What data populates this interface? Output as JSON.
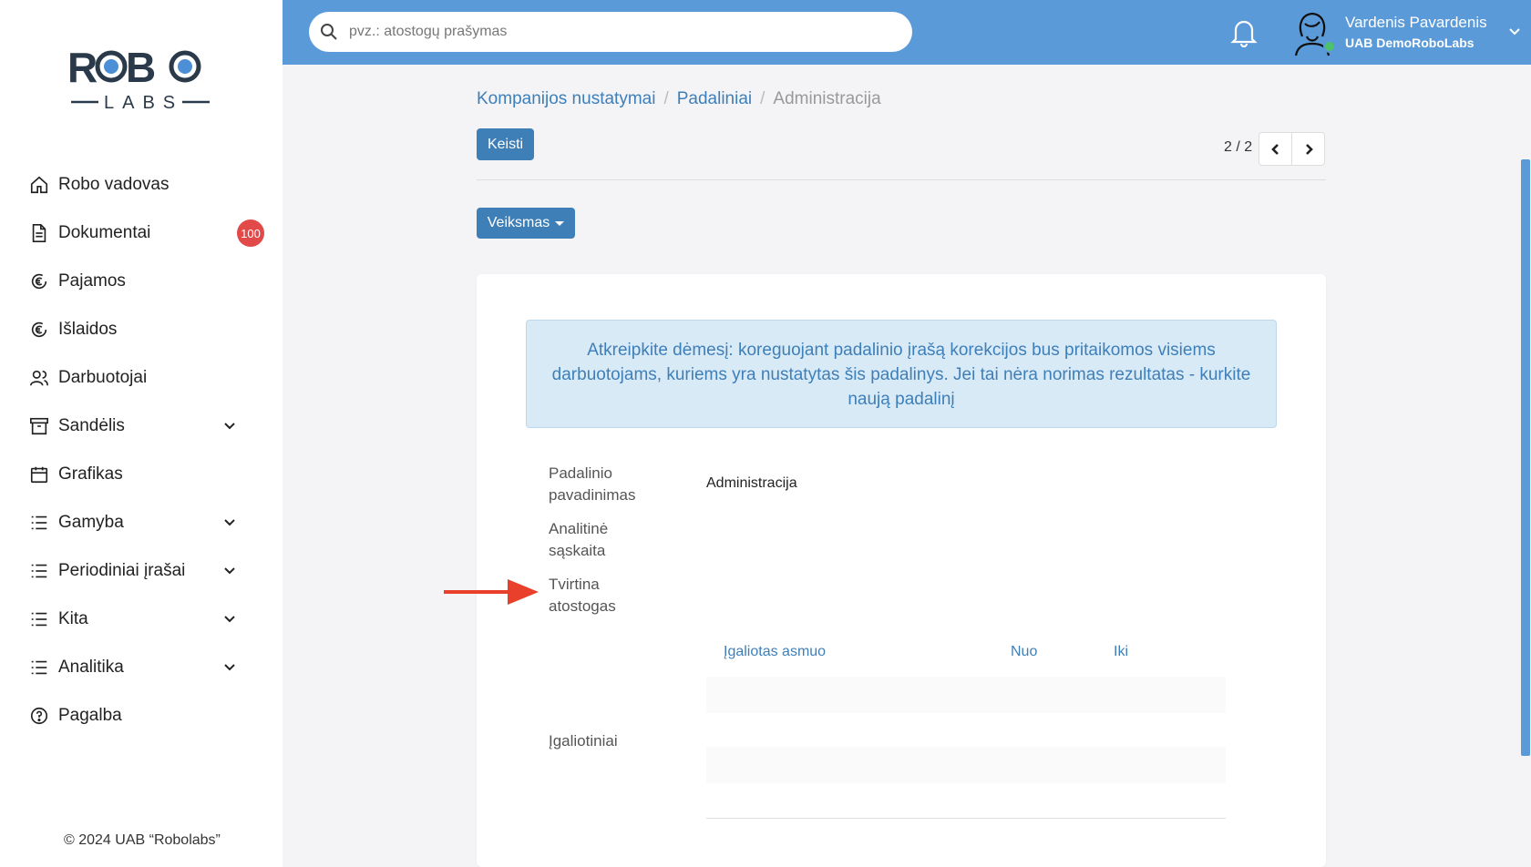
{
  "sidebar": {
    "logo": {
      "top": "ROBO",
      "bottom": "LABS"
    },
    "items": [
      {
        "label": "Robo vadovas",
        "icon": "home-icon"
      },
      {
        "label": "Dokumentai",
        "icon": "document-icon",
        "badge": "100"
      },
      {
        "label": "Pajamos",
        "icon": "euro-circle-icon"
      },
      {
        "label": "Išlaidos",
        "icon": "euro-circle-icon"
      },
      {
        "label": "Darbuotojai",
        "icon": "users-icon"
      },
      {
        "label": "Sandėlis",
        "icon": "archive-box-icon",
        "expandable": true
      },
      {
        "label": "Grafikas",
        "icon": "calendar-icon"
      },
      {
        "label": "Gamyba",
        "icon": "list-icon",
        "expandable": true
      },
      {
        "label": "Periodiniai įrašai",
        "icon": "list-icon",
        "expandable": true
      },
      {
        "label": "Kita",
        "icon": "list-icon",
        "expandable": true
      },
      {
        "label": "Analitika",
        "icon": "list-icon",
        "expandable": true
      },
      {
        "label": "Pagalba",
        "icon": "help-circle-icon"
      }
    ],
    "copyright": "© 2024 UAB “Robolabs”"
  },
  "topbar": {
    "search_placeholder": "pvz.: atostogų prašymas",
    "user_name": "Vardenis Pavardenis",
    "user_company": "UAB DemoRoboLabs",
    "online_color": "#4cc26a"
  },
  "breadcrumb": {
    "items": [
      "Kompanijos nustatymai",
      "Padaliniai"
    ],
    "current": "Administracija"
  },
  "toolbar": {
    "edit_label": "Keisti",
    "pager": "2 / 2",
    "action_label": "Veiksmas"
  },
  "form": {
    "alert": "Atkreipkite dėmesį: koreguojant padalinio įrašą korekcijos bus pritaikomos visiems darbuotojams, kuriems yra nustatytas šis padalinys. Jei tai nėra norimas rezultatas - kurkite naują padalinį",
    "fields": {
      "name_label": "Padalinio pavadinimas",
      "name_value": "Administracija",
      "analytic_label": "Analitinė sąskaita",
      "approves_label": "Tvirtina atostogas",
      "authorizations_label": "Įgaliotiniai"
    },
    "table": {
      "columns": [
        "Įgaliotas asmuo",
        "Nuo",
        "Iki"
      ]
    }
  },
  "colors": {
    "accent": "#5b9ad8",
    "primary_button": "#3e7fb8",
    "badge": "#e24a4a",
    "arrow": "#e8402a"
  }
}
